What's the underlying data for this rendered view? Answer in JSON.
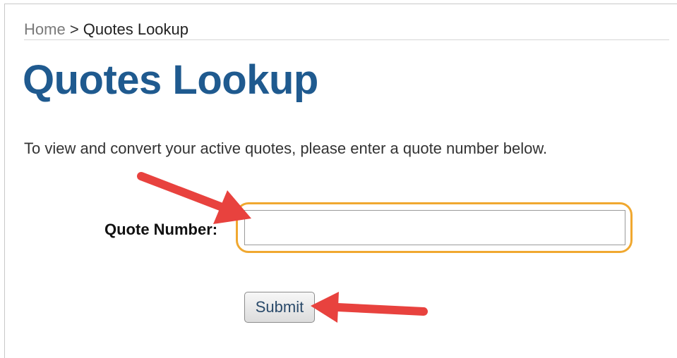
{
  "breadcrumb": {
    "home": "Home",
    "separator": ">",
    "current": "Quotes Lookup"
  },
  "page": {
    "title": "Quotes Lookup",
    "intro": "To view and convert your active quotes, please enter a quote number below."
  },
  "form": {
    "quote_number_label": "Quote Number:",
    "quote_number_value": "",
    "submit_label": "Submit"
  },
  "colors": {
    "title": "#1f5a8f",
    "highlight": "#f0a830",
    "arrow": "#e8423e"
  }
}
